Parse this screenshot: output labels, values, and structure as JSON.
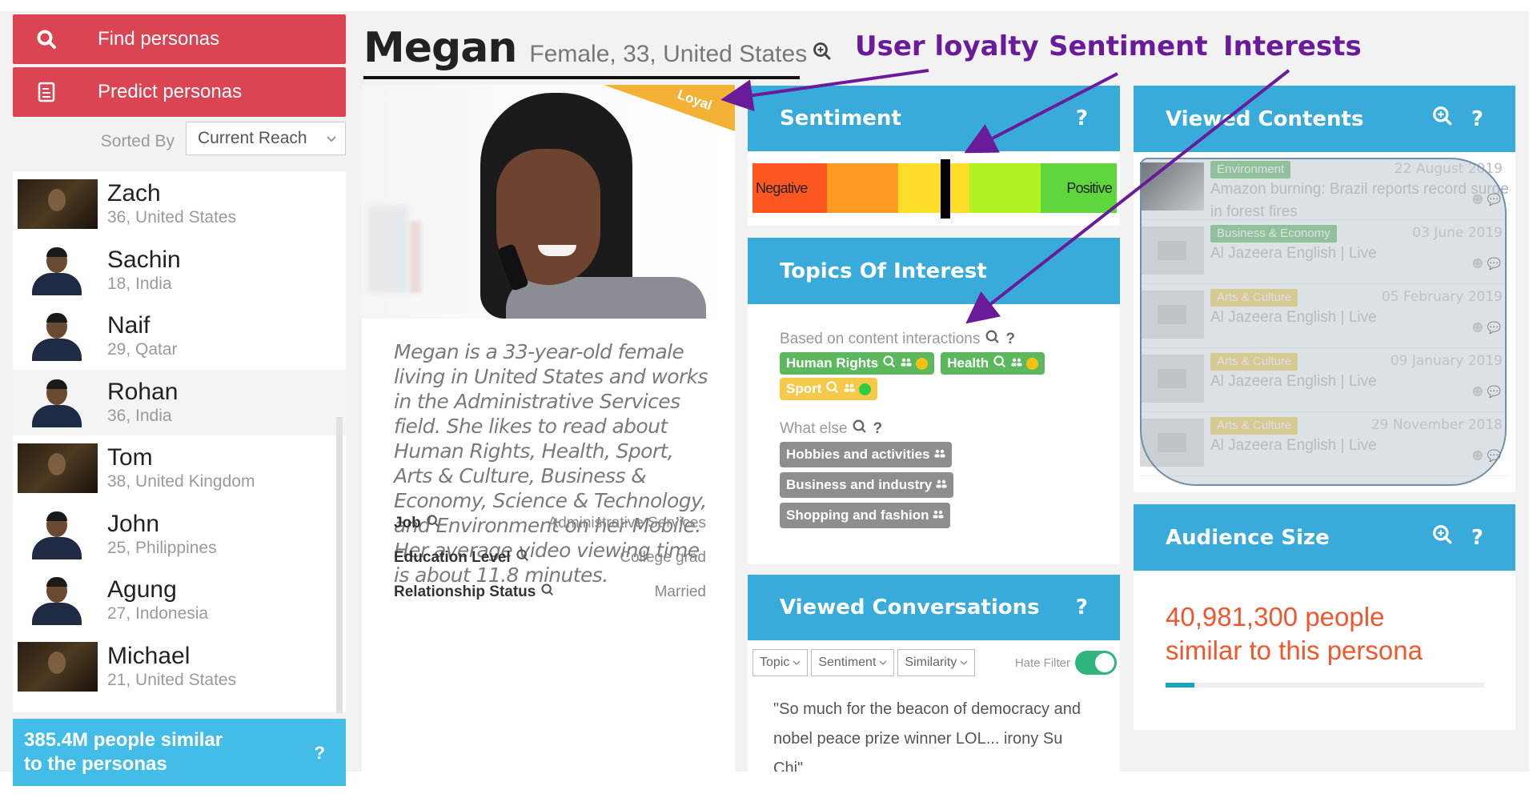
{
  "sidebar": {
    "find_label": "Find personas",
    "predict_label": "Predict personas",
    "sorted_by_label": "Sorted By",
    "sort_value": "Current Reach",
    "personas": [
      {
        "name": "Zach",
        "meta": "36, United States",
        "avatar": "photo-dark"
      },
      {
        "name": "Sachin",
        "meta": "18, India",
        "avatar": "cutout"
      },
      {
        "name": "Naif",
        "meta": "29, Qatar",
        "avatar": "cutout"
      },
      {
        "name": "Rohan",
        "meta": "36, India",
        "avatar": "cutout",
        "selected": true
      },
      {
        "name": "Tom",
        "meta": "38, United Kingdom",
        "avatar": "photo-dark"
      },
      {
        "name": "John",
        "meta": "25, Philippines",
        "avatar": "cutout"
      },
      {
        "name": "Agung",
        "meta": "27, Indonesia",
        "avatar": "cutout"
      },
      {
        "name": "Michael",
        "meta": "21, United States",
        "avatar": "photo-dark"
      }
    ],
    "similar_line1": "385.4M people similar",
    "similar_line2": "to the personas",
    "help": "?"
  },
  "persona": {
    "name": "Megan",
    "meta": "Female, 33, United States",
    "loyalty_badge": "Loyal",
    "bio": "Megan is a 33-year-old female living in United States and works in the Administrative Services field. She likes to read about Human Rights, Health, Sport, Arts & Culture, Business & Economy, Science & Technology, and Environment on her Mobile. Her average video viewing time is about 11.8 minutes.",
    "attributes": [
      {
        "label": "Job",
        "value": "Administrative Services"
      },
      {
        "label": "Education Level",
        "value": "College grad"
      },
      {
        "label": "Relationship Status",
        "value": "Married"
      }
    ]
  },
  "annotations": {
    "user_loyalty": "User loyalty",
    "sentiment": "Sentiment",
    "interests": "Interests",
    "color": "#6a1b9a"
  },
  "sentiment": {
    "title": "Sentiment",
    "help": "?",
    "negative_label": "Negative",
    "positive_label": "Positive",
    "segments": [
      "#ff5722",
      "#ff9a22",
      "#fddc2a",
      "#b2f224",
      "#5ed63c"
    ],
    "marker_position": 0.53
  },
  "topics": {
    "title": "Topics Of Interest",
    "based_on_label": "Based on content interactions",
    "help": "?",
    "tags": [
      {
        "label": "Human Rights",
        "color": "green",
        "sentiment": "neutral"
      },
      {
        "label": "Health",
        "color": "green",
        "sentiment": "neutral"
      },
      {
        "label": "Sport",
        "color": "yellow",
        "sentiment": "positive"
      }
    ],
    "what_else_label": "What else",
    "other_tags": [
      "Hobbies and activities",
      "Business and industry",
      "Shopping and fashion"
    ]
  },
  "conversations": {
    "title": "Viewed Conversations",
    "help": "?",
    "filters": [
      "Topic",
      "Sentiment",
      "Similarity"
    ],
    "hate_filter_label": "Hate Filter",
    "hate_filter_on": true,
    "quote": "\"So much for the beacon of democracy and nobel peace prize winner LOL... irony Su Chi\""
  },
  "viewed_contents": {
    "title": "Viewed Contents",
    "help": "?",
    "items": [
      {
        "tag": "Environment",
        "tag_color": "#5cb85c",
        "date": "22 August 2019",
        "title": "Amazon burning: Brazil reports record surge in forest fires",
        "thumb": "dark"
      },
      {
        "tag": "Business & Economy",
        "tag_color": "#5cb85c",
        "date": "03 June 2019",
        "title": "Al Jazeera English | Live",
        "thumb": "tv"
      },
      {
        "tag": "Arts & Culture",
        "tag_color": "#f6c94a",
        "date": "05 February 2019",
        "title": "Al Jazeera English | Live",
        "thumb": "tv"
      },
      {
        "tag": "Arts & Culture",
        "tag_color": "#f6c94a",
        "date": "09 January 2019",
        "title": "Al Jazeera English | Live",
        "thumb": "tv"
      },
      {
        "tag": "Arts & Culture",
        "tag_color": "#f6c94a",
        "date": "29 November 2018",
        "title": "Al Jazeera English | Live",
        "thumb": "tv"
      }
    ]
  },
  "audience": {
    "title": "Audience Size",
    "help": "?",
    "line1": "40,981,300 people",
    "line2": "similar to this persona",
    "progress": 0.09
  },
  "colors": {
    "brand_red": "#da4453",
    "panel_blue": "#39abda",
    "footer_blue": "#43bce7",
    "audience_orange": "#f0572c",
    "loyal_gold": "#f3b136"
  }
}
